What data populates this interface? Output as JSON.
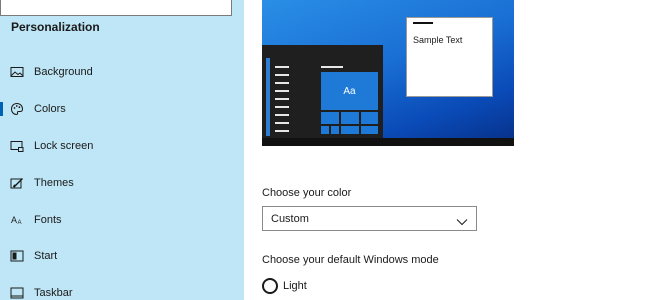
{
  "sidebar": {
    "heading": "Personalization",
    "items": [
      {
        "label": "Background",
        "icon": "picture-icon"
      },
      {
        "label": "Colors",
        "icon": "palette-icon",
        "selected": true
      },
      {
        "label": "Lock screen",
        "icon": "monitor-lock-icon"
      },
      {
        "label": "Themes",
        "icon": "brush-icon"
      },
      {
        "label": "Fonts",
        "icon": "font-icon"
      },
      {
        "label": "Start",
        "icon": "start-grid-icon"
      },
      {
        "label": "Taskbar",
        "icon": "taskbar-icon"
      }
    ]
  },
  "preview": {
    "tile_text": "Aa",
    "window_text": "Sample Text"
  },
  "color_section": {
    "label": "Choose your color",
    "selected": "Custom"
  },
  "mode_section": {
    "label": "Choose your default Windows mode",
    "options": [
      {
        "label": "Light",
        "selected": false
      }
    ]
  },
  "colors": {
    "sidebar_bg": "#bfe6f6",
    "accent": "#0063b1",
    "tile": "#1e7ad6"
  }
}
